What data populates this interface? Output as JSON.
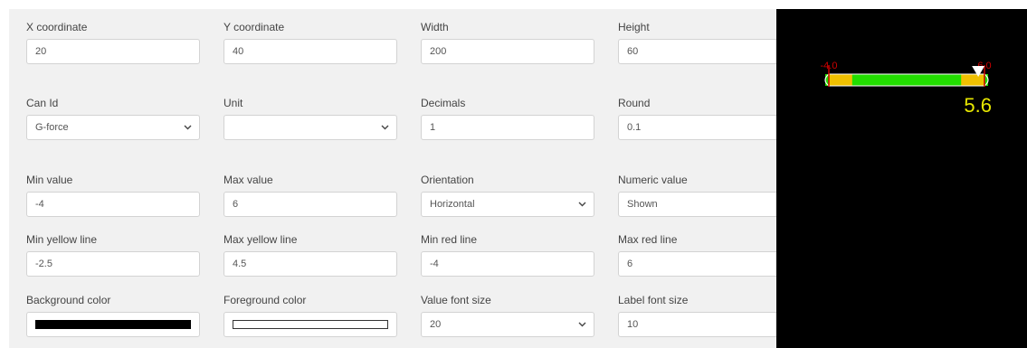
{
  "form": {
    "x": {
      "label": "X coordinate",
      "value": "20"
    },
    "y": {
      "label": "Y coordinate",
      "value": "40"
    },
    "width": {
      "label": "Width",
      "value": "200"
    },
    "height": {
      "label": "Height",
      "value": "60"
    },
    "can_id": {
      "label": "Can Id",
      "value": "G-force"
    },
    "unit": {
      "label": "Unit",
      "value": ""
    },
    "decimals": {
      "label": "Decimals",
      "value": "1"
    },
    "round": {
      "label": "Round",
      "value": "0.1"
    },
    "min_value": {
      "label": "Min value",
      "value": "-4"
    },
    "max_value": {
      "label": "Max value",
      "value": "6"
    },
    "orientation": {
      "label": "Orientation",
      "value": "Horizontal"
    },
    "numeric_value": {
      "label": "Numeric value",
      "value": "Shown"
    },
    "min_yellow": {
      "label": "Min yellow line",
      "value": "-2.5"
    },
    "max_yellow": {
      "label": "Max yellow line",
      "value": "4.5"
    },
    "min_red": {
      "label": "Min red line",
      "value": "-4"
    },
    "max_red": {
      "label": "Max red line",
      "value": "6"
    },
    "bg_color": {
      "label": "Background color",
      "value": "#000000"
    },
    "fg_color": {
      "label": "Foreground color",
      "value": "#ffffff"
    },
    "value_font_size": {
      "label": "Value font size",
      "value": "20"
    },
    "label_font_size": {
      "label": "Label font size",
      "value": "10"
    }
  },
  "gauge": {
    "min_label": "-4.0",
    "max_label": "6.0",
    "value_text": "5.6",
    "min": -4,
    "max": 6,
    "value": 5.6,
    "yellow_min": -2.5,
    "yellow_max": 4.5,
    "colors": {
      "green": "#22dd00",
      "yellow": "#f0c000",
      "red": "#cc0000",
      "value": "#e8e800",
      "outline": "#ffffff"
    }
  }
}
